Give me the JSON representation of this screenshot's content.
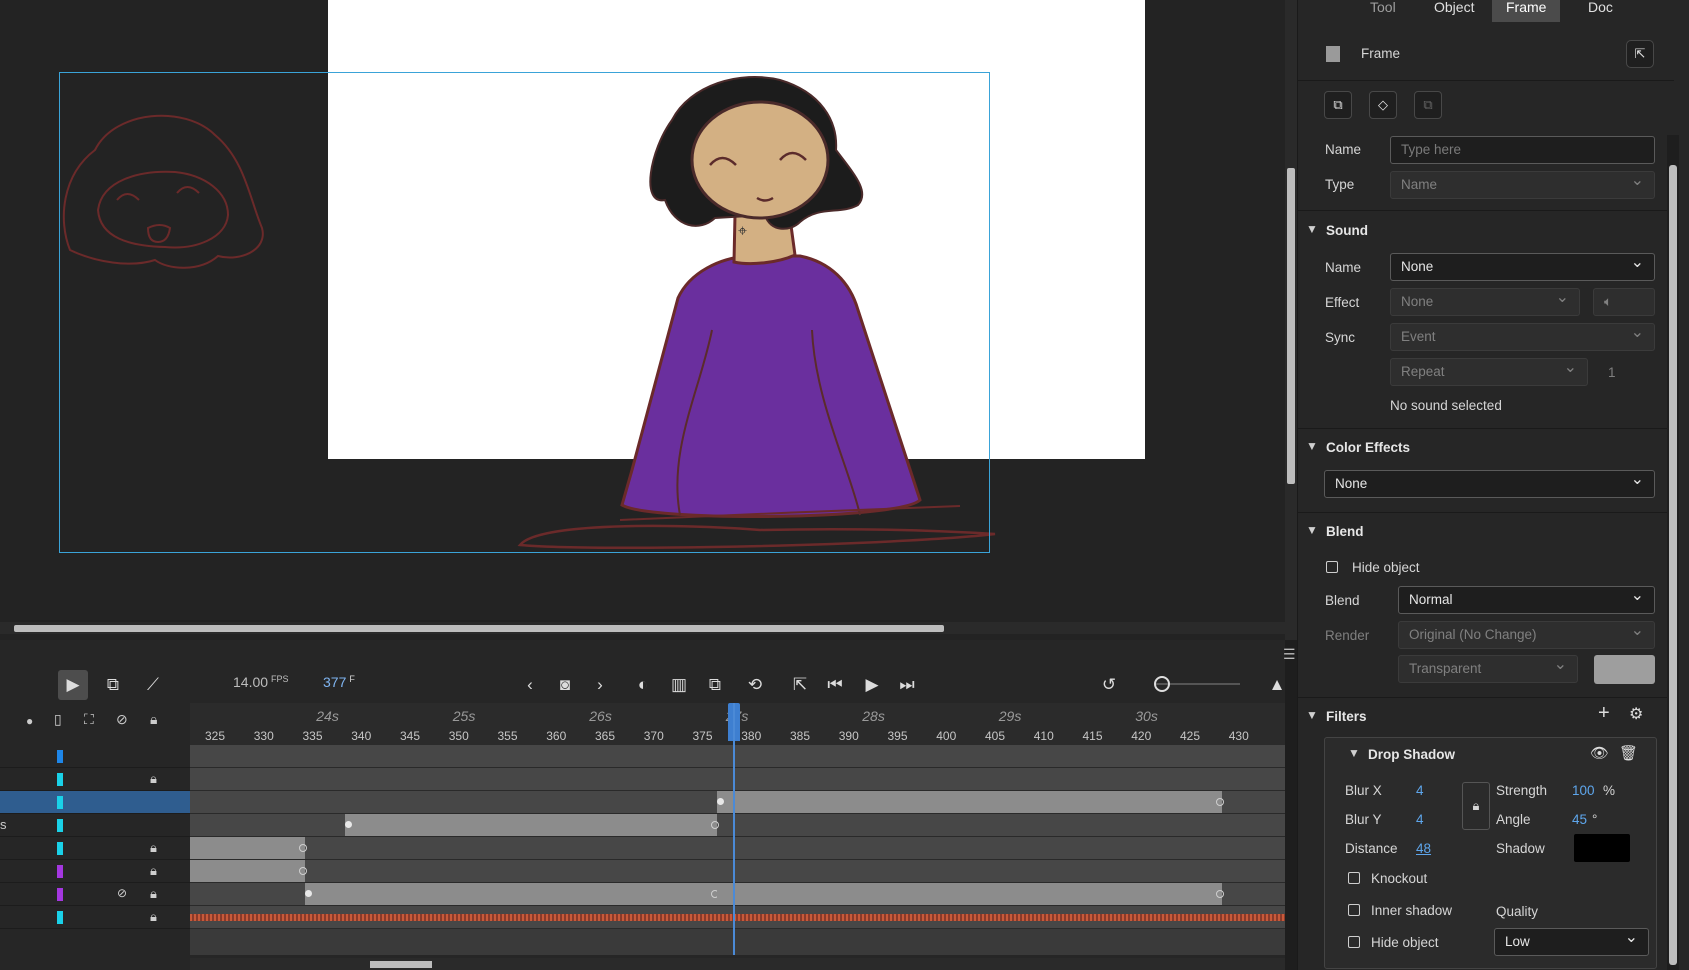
{
  "timeline_toolbar": {
    "fps": "14.00",
    "fps_unit": "FPS",
    "current_frame": "377",
    "frame_unit": "F"
  },
  "ruler": {
    "seconds": [
      "24s",
      "25s",
      "26s",
      "27s",
      "28s",
      "29s",
      "30s"
    ],
    "frames": [
      "325",
      "330",
      "335",
      "340",
      "345",
      "350",
      "355",
      "360",
      "365",
      "370",
      "375",
      "380",
      "385",
      "390",
      "395",
      "400",
      "405",
      "410",
      "415",
      "420",
      "425",
      "430"
    ]
  },
  "layers": [
    {
      "color": "#1e86e8",
      "locked": false,
      "selected": false,
      "label": ""
    },
    {
      "color": "#1ad1e8",
      "locked": true,
      "selected": false,
      "label": ""
    },
    {
      "color": "#1ad1e8",
      "locked": false,
      "selected": true,
      "label": ""
    },
    {
      "color": "#1ad1e8",
      "locked": false,
      "selected": false,
      "label": "s"
    },
    {
      "color": "#1ad1e8",
      "locked": true,
      "selected": false,
      "label": ""
    },
    {
      "color": "#a437e0",
      "locked": true,
      "selected": false,
      "label": ""
    },
    {
      "color": "#a437e0",
      "locked": true,
      "selected": false,
      "hidden": true,
      "label": ""
    },
    {
      "color": "#1ad1e8",
      "locked": true,
      "selected": false,
      "label": ""
    }
  ],
  "props": {
    "tabs": [
      "Tool",
      "Object",
      "Frame",
      "Doc"
    ],
    "active_tab": "Frame",
    "header_title": "Frame",
    "name_label": "Name",
    "name_placeholder": "Type here",
    "type_label": "Type",
    "type_value": "Name",
    "sound": {
      "title": "Sound",
      "name_label": "Name",
      "name_value": "None",
      "effect_label": "Effect",
      "effect_value": "None",
      "sync_label": "Sync",
      "sync_value": "Event",
      "repeat_value": "Repeat",
      "repeat_count": "1",
      "status": "No sound selected"
    },
    "color_effects": {
      "title": "Color Effects",
      "value": "None"
    },
    "blend": {
      "title": "Blend",
      "hide_object": "Hide object",
      "blend_label": "Blend",
      "blend_value": "Normal",
      "render_label": "Render",
      "render_value": "Original (No Change)",
      "transparent_value": "Transparent"
    },
    "filters": {
      "title": "Filters",
      "drop_shadow": "Drop Shadow",
      "blur_x_label": "Blur X",
      "blur_x": "4",
      "blur_y_label": "Blur Y",
      "blur_y": "4",
      "strength_label": "Strength",
      "strength": "100",
      "strength_unit": "%",
      "angle_label": "Angle",
      "angle": "45",
      "angle_unit": "°",
      "distance_label": "Distance",
      "distance": "48",
      "shadow_label": "Shadow",
      "knockout": "Knockout",
      "inner_shadow": "Inner shadow",
      "quality_label": "Quality",
      "hide_object": "Hide object",
      "quality_value": "Low"
    }
  },
  "colors": {
    "accent": "#4b8ad6",
    "hair": "#1c1c1c",
    "skin": "#d3b083",
    "shirt": "#6a2f9e",
    "outline": "#6b2a2a",
    "shadow_swatch": "#000000"
  }
}
